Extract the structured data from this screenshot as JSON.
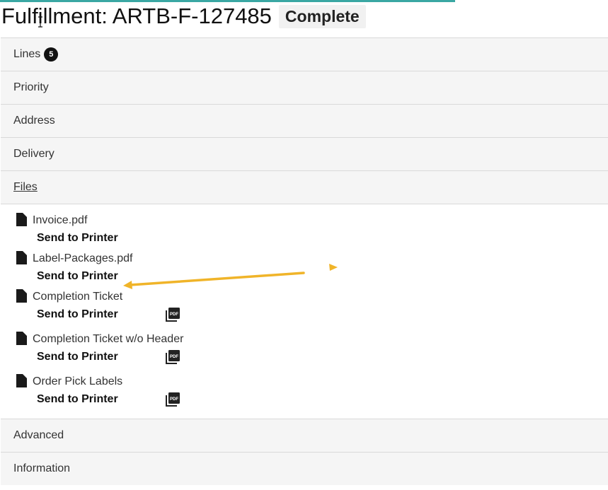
{
  "header": {
    "title": "Fulfillment: ARTB-F-127485",
    "status": "Complete"
  },
  "sections": {
    "lines": {
      "label": "Lines",
      "badge": "5"
    },
    "priority": {
      "label": "Priority"
    },
    "address": {
      "label": "Address"
    },
    "delivery": {
      "label": "Delivery"
    },
    "files": {
      "label": "Files"
    },
    "advanced": {
      "label": "Advanced"
    },
    "information": {
      "label": "Information"
    }
  },
  "files": [
    {
      "name": "Invoice.pdf",
      "action": "Send to Printer",
      "has_pdf": false
    },
    {
      "name": "Label-Packages.pdf",
      "action": "Send to Printer",
      "has_pdf": false
    },
    {
      "name": "Completion Ticket",
      "action": "Send to Printer",
      "has_pdf": true
    },
    {
      "name": "Completion Ticket w/o Header",
      "action": "Send to Printer",
      "has_pdf": true
    },
    {
      "name": "Order Pick Labels",
      "action": "Send to Printer",
      "has_pdf": true
    }
  ],
  "icons": {
    "file": "document-icon",
    "pdf": "pdf-icon"
  },
  "colors": {
    "accent": "#3aa7a3",
    "annotation_arrow": "#f0b429",
    "section_bg": "#f5f5f5"
  }
}
